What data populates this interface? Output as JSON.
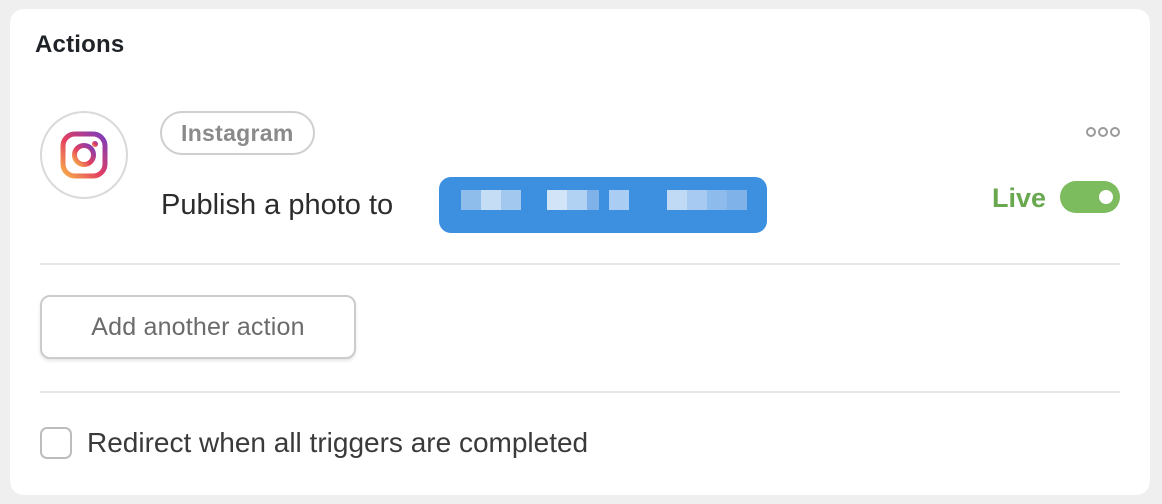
{
  "card": {
    "title": "Actions"
  },
  "action": {
    "app_name": "Instagram",
    "app_icon": "instagram-icon",
    "text": "Publish a photo to",
    "target_redacted": true,
    "status_label": "Live",
    "status_on": true,
    "more_icon": "more-horizontal-icon"
  },
  "add_action": {
    "label": "Add another action"
  },
  "redirect": {
    "label": "Redirect when all triggers are completed",
    "checked": false
  },
  "colors": {
    "live_green": "#6aa84f",
    "toggle_green": "#7cbb5e",
    "target_blue": "#3d8fe0"
  }
}
